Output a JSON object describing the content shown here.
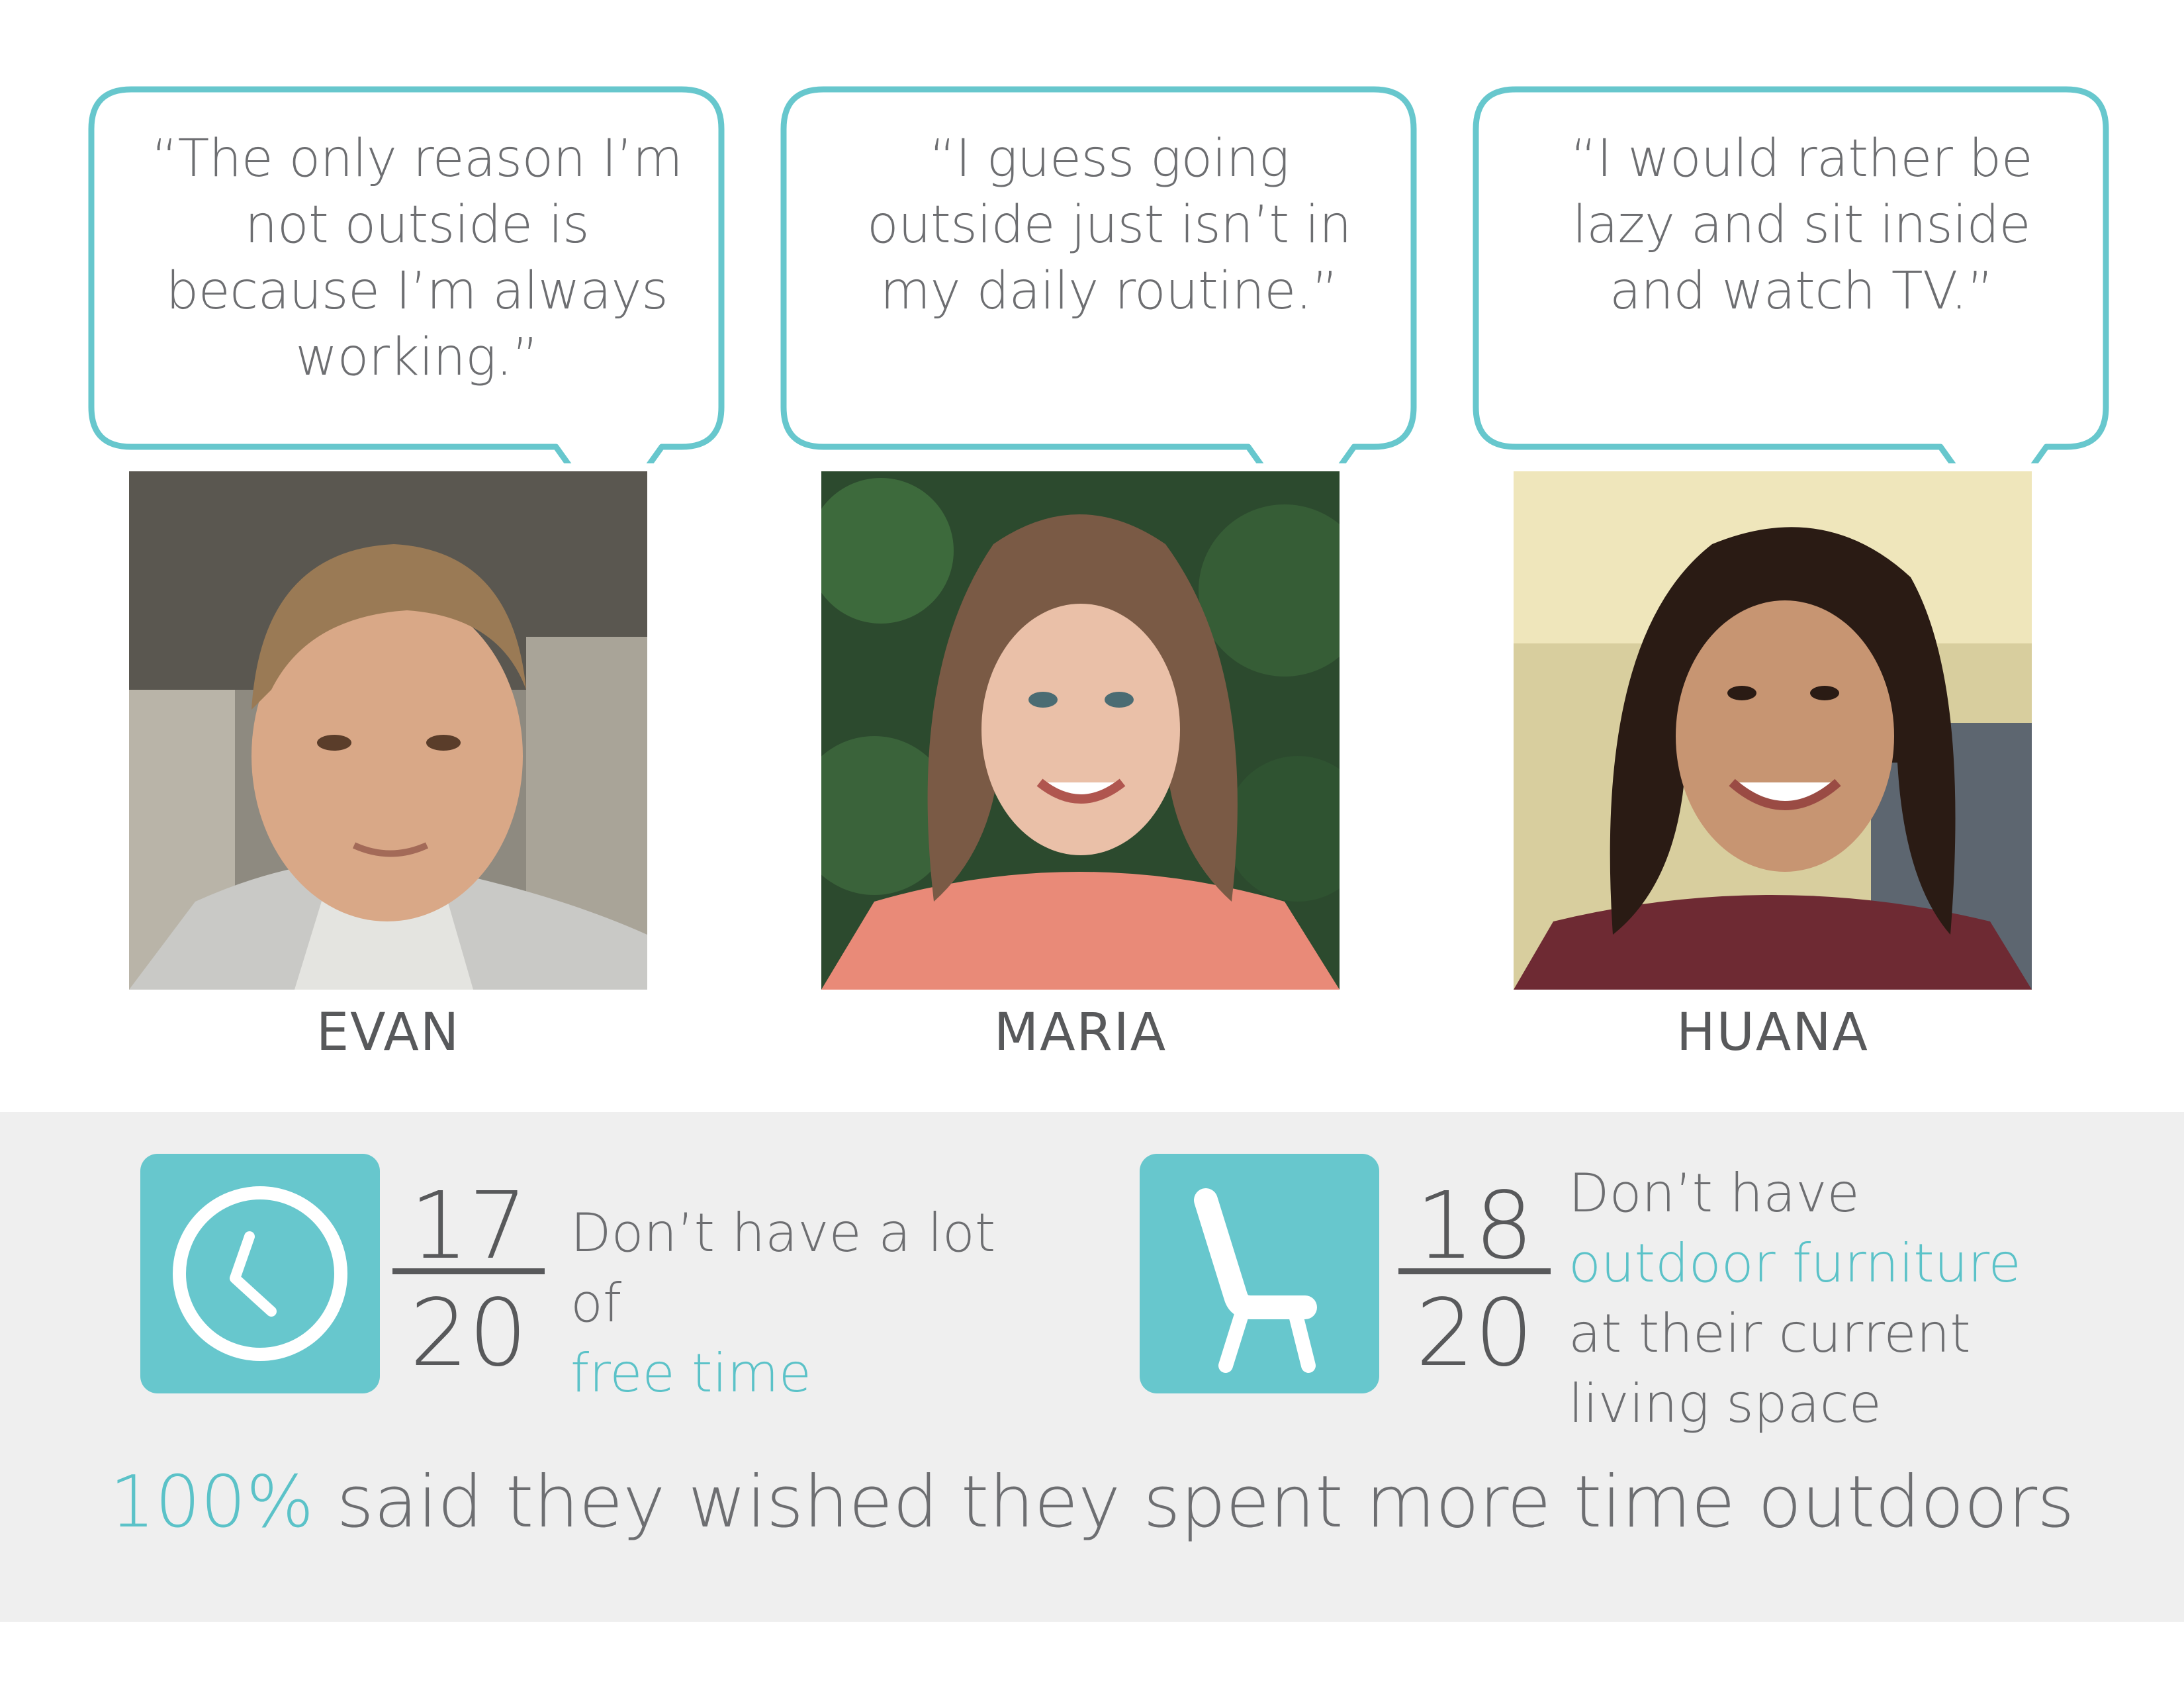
{
  "colors": {
    "accent": "#67c7cd",
    "text": "#58595b",
    "band": "#efefef"
  },
  "personas": [
    {
      "quote": "“The only reason I’m not outside is because I’m always working.”",
      "name": "EVAN",
      "photo_alt": "photo-of-evan"
    },
    {
      "quote": "“I guess going outside just isn’t in my daily routine.”",
      "name": "MARIA",
      "photo_alt": "photo-of-maria"
    },
    {
      "quote": "“I would rather be lazy and sit inside and watch TV.”",
      "name": "HUANA",
      "photo_alt": "photo-of-huana"
    }
  ],
  "stats": [
    {
      "icon": "clock-icon",
      "numerator": "17",
      "denominator": "20",
      "text_plain": "Don’t have a lot of",
      "text_accent": "free time"
    },
    {
      "icon": "chair-icon",
      "numerator": "18",
      "denominator": "20",
      "text_plain_1": "Don’t have",
      "text_accent": "outdoor furniture",
      "text_plain_2": "at their current living space"
    }
  ],
  "summary": {
    "percent": "100%",
    "text": "said they wished they spent more time outdoors"
  }
}
